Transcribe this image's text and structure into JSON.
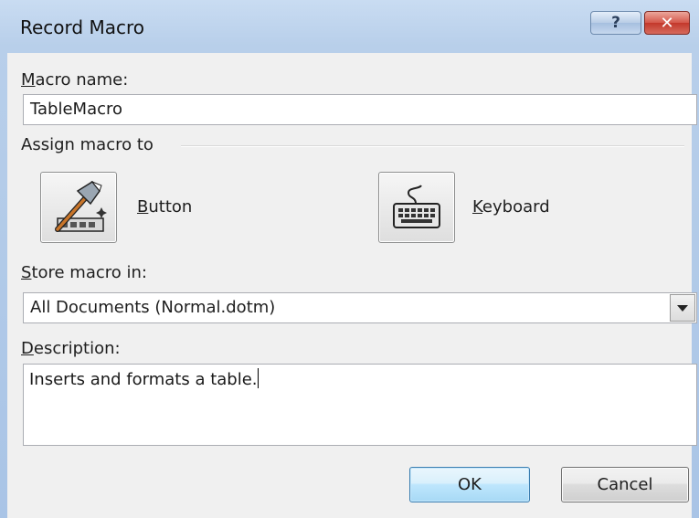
{
  "window": {
    "title": "Record Macro",
    "help_glyph": "?",
    "close_glyph": "✕"
  },
  "macro_name": {
    "label_mnemonic": "M",
    "label_rest": "acro name:",
    "value": "TableMacro"
  },
  "assign": {
    "group_label": "Assign macro to",
    "button_mnemonic": "B",
    "button_rest": "utton",
    "button_icon": "hammer-toolbar-icon",
    "keyboard_mnemonic": "K",
    "keyboard_rest": "eyboard",
    "keyboard_icon": "keyboard-icon"
  },
  "store": {
    "label_mnemonic": "S",
    "label_rest": "tore macro in:",
    "selected": "All Documents (Normal.dotm)"
  },
  "description": {
    "label_mnemonic": "D",
    "label_rest": "escription:",
    "value": "Inserts and formats a table."
  },
  "actions": {
    "ok": "OK",
    "cancel": "Cancel"
  },
  "colors": {
    "frame": "#b8cfea",
    "client_bg": "#f0f0f0",
    "close_red": "#c3382b",
    "ok_blue": "#bee6fd"
  }
}
